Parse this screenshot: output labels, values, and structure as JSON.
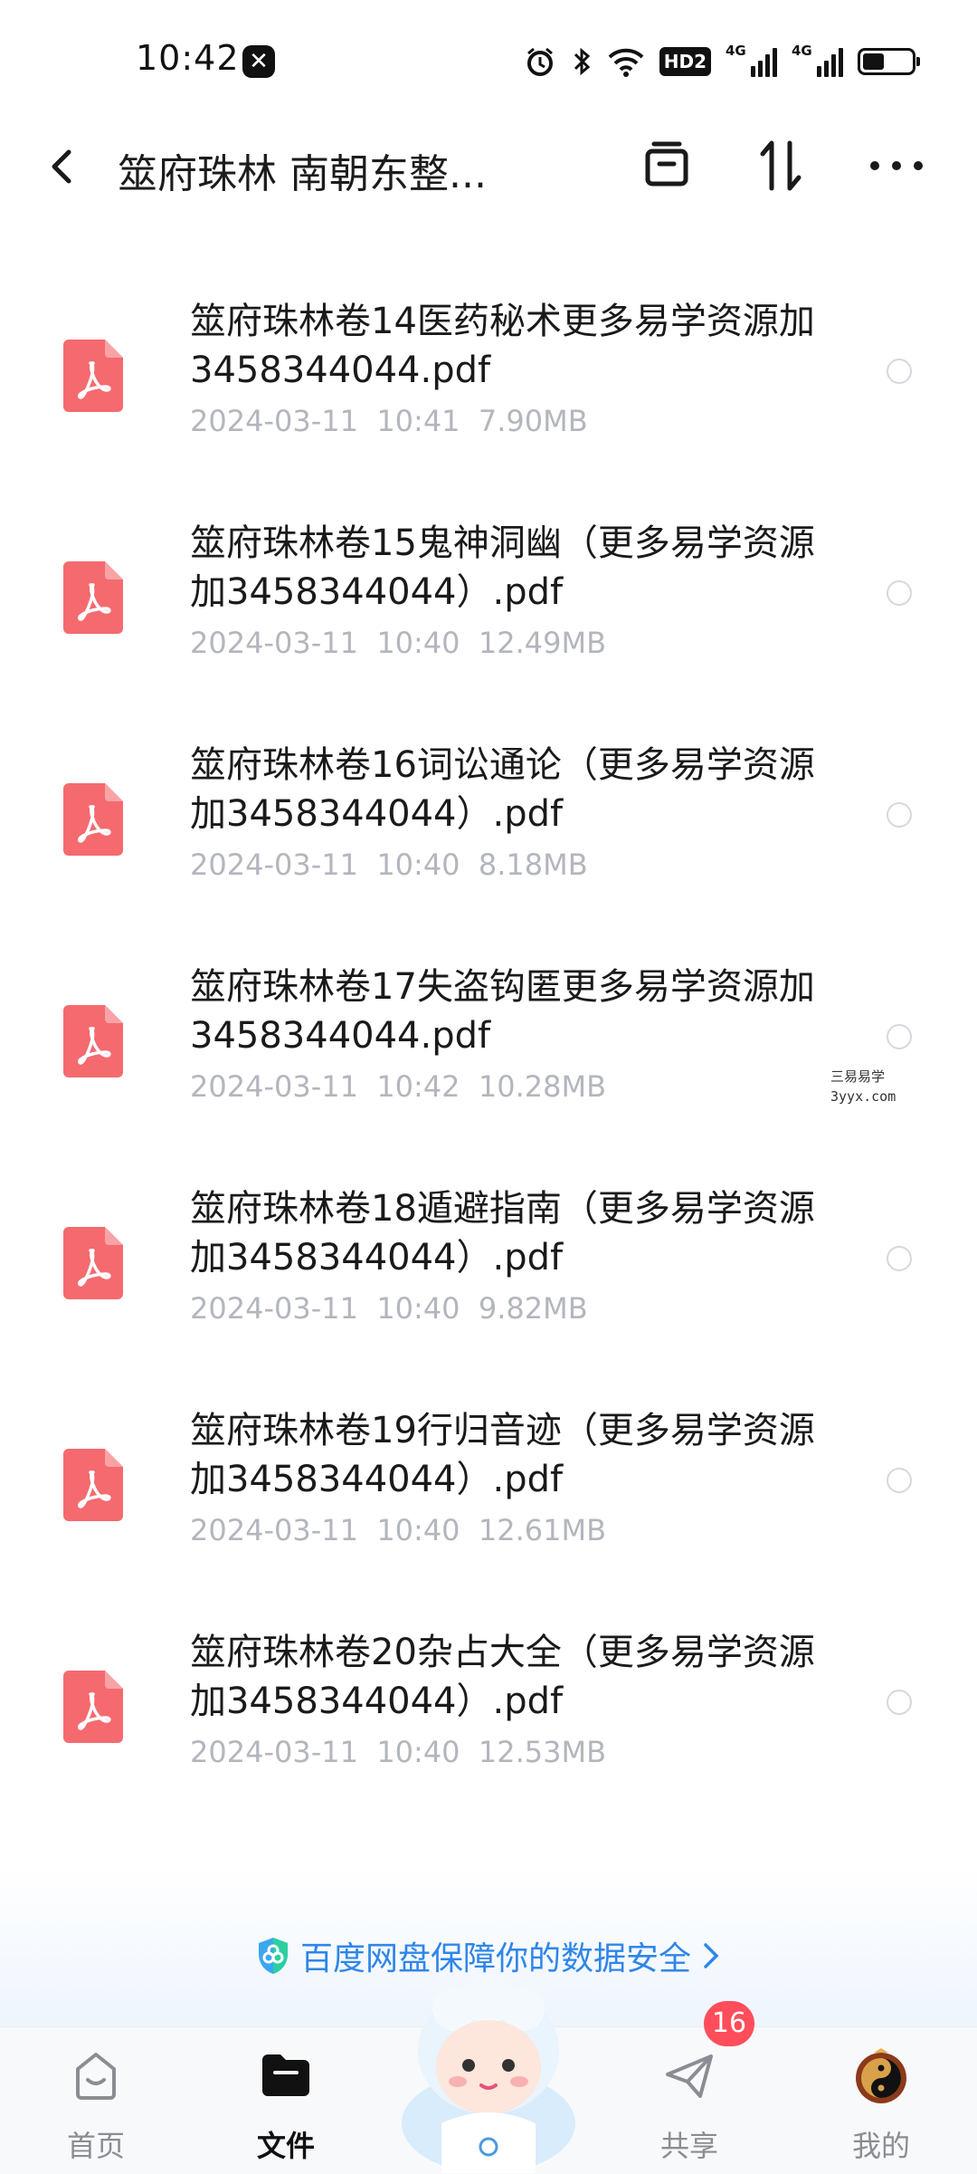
{
  "status_bar": {
    "time": "10:42",
    "app_badge": "✕",
    "hd_label": "HD2",
    "network_1": "4G",
    "network_2": "4G",
    "battery_level": 0.45
  },
  "header": {
    "title": "筮府珠林 南朝东整..."
  },
  "files": [
    {
      "name": "筮府珠林卷14医药秘术更多易学资源加3458344044.pdf",
      "date": "2024-03-11",
      "time": "10:41",
      "size": "7.90MB"
    },
    {
      "name": "筮府珠林卷15鬼神洞幽（更多易学资源加3458344044）.pdf",
      "date": "2024-03-11",
      "time": "10:40",
      "size": "12.49MB"
    },
    {
      "name": "筮府珠林卷16词讼通论（更多易学资源加3458344044）.pdf",
      "date": "2024-03-11",
      "time": "10:40",
      "size": "8.18MB"
    },
    {
      "name": "筮府珠林卷17失盗钩匿更多易学资源加3458344044.pdf",
      "date": "2024-03-11",
      "time": "10:42",
      "size": "10.28MB"
    },
    {
      "name": "筮府珠林卷18遁避指南（更多易学资源加3458344044）.pdf",
      "date": "2024-03-11",
      "time": "10:40",
      "size": "9.82MB"
    },
    {
      "name": "筮府珠林卷19行归音迹（更多易学资源加3458344044）.pdf",
      "date": "2024-03-11",
      "time": "10:40",
      "size": "12.61MB"
    },
    {
      "name": "筮府珠林卷20杂占大全（更多易学资源加3458344044）.pdf",
      "date": "2024-03-11",
      "time": "10:40",
      "size": "12.53MB"
    }
  ],
  "watermark": {
    "line1": "三易易学",
    "line2": "3yyx.com"
  },
  "security_banner": {
    "text": "百度网盘保障你的数据安全",
    "color": "#2f86e8"
  },
  "bottom_nav": {
    "home": "首页",
    "files": "文件",
    "share": "共享",
    "share_badge": "16",
    "mine": "我的"
  },
  "colors": {
    "pdf_icon": "#f46a6f",
    "badge": "#ff4d5b",
    "meta_text": "#b3b6bd"
  }
}
